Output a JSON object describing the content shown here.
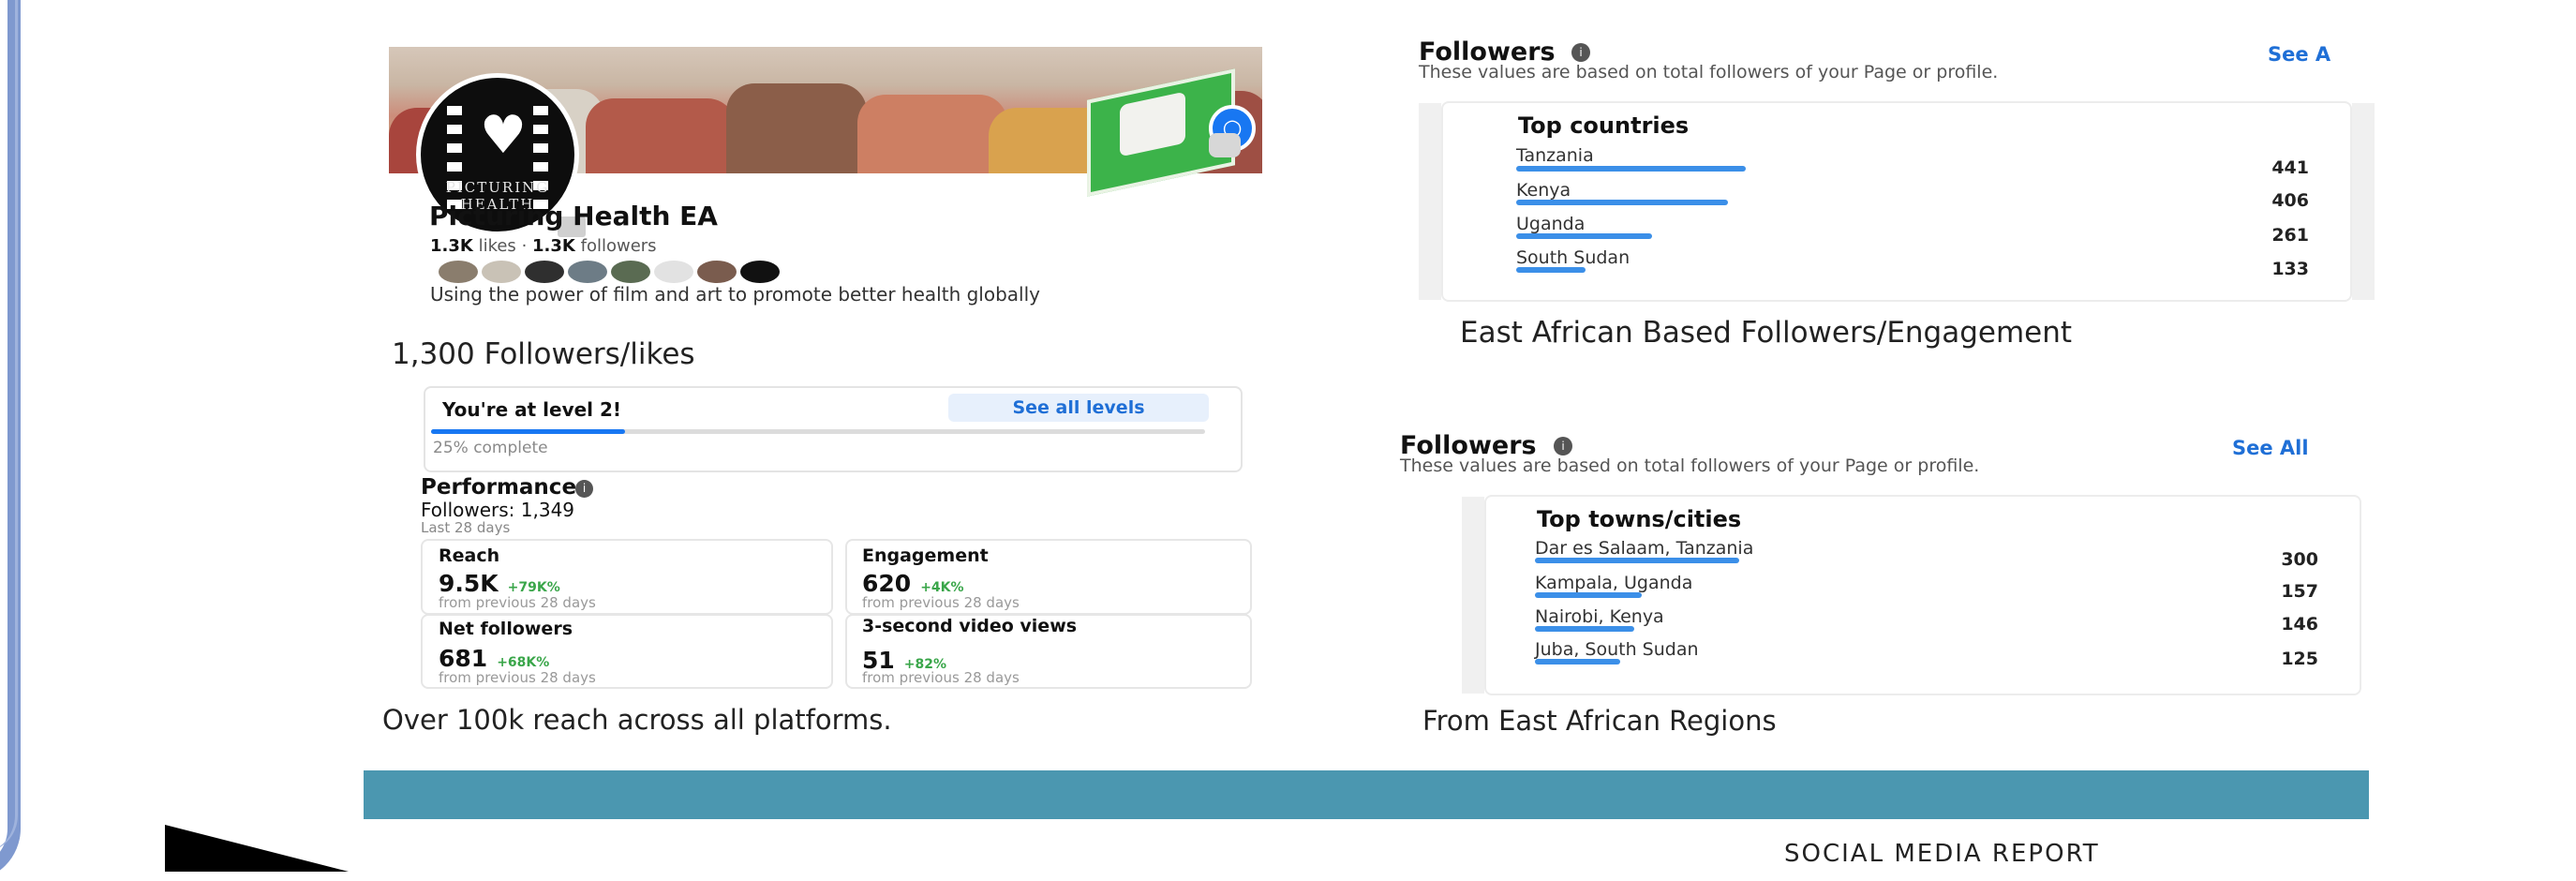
{
  "profile": {
    "avatar_text": "PICTURING HEALTH",
    "name": "Picturing Health EA",
    "likes_count": "1.3K",
    "likes_label": "likes",
    "separator": "·",
    "followers_count": "1.3K",
    "followers_label": "followers",
    "bio": "Using the power of film and art to promote better health globally"
  },
  "captions": {
    "followers_likes": "1,300 Followers/likes",
    "reach": "Over 100k reach across all platforms.",
    "east_african": "East African Based Followers/Engagement",
    "regions": "From East African Regions"
  },
  "level": {
    "title": "You're at level 2!",
    "see_all": "See all levels",
    "progress_percent": 25,
    "progress_text": "25% complete"
  },
  "performance": {
    "title": "Performance",
    "followers": "Followers: 1,349",
    "period": "Last 28 days",
    "metrics": [
      {
        "label": "Reach",
        "value": "9.5K",
        "change": "+79K%",
        "sub": "from previous 28 days"
      },
      {
        "label": "Engagement",
        "value": "620",
        "change": "+4K%",
        "sub": "from previous 28 days"
      },
      {
        "label": "Net followers",
        "value": "681",
        "change": "+68K%",
        "sub": "from previous 28 days"
      },
      {
        "label": "3-second video views",
        "value": "51",
        "change": "+82%",
        "sub": "from previous 28 days"
      }
    ]
  },
  "countries_panel": {
    "title": "Followers",
    "see_all": "See A",
    "description": "These values are based on total followers of your Page or profile.",
    "heading": "Top countries",
    "rows": [
      {
        "name": "Tanzania",
        "value": "441",
        "share": 441
      },
      {
        "name": "Kenya",
        "value": "406",
        "share": 406
      },
      {
        "name": "Uganda",
        "value": "261",
        "share": 261
      },
      {
        "name": "South Sudan",
        "value": "133",
        "share": 133
      }
    ]
  },
  "cities_panel": {
    "title": "Followers",
    "see_all": "See All",
    "description": "These values are based on total followers of your Page or profile.",
    "heading": "Top towns/cities",
    "rows": [
      {
        "name": "Dar es Salaam, Tanzania",
        "value": "300",
        "share": 300
      },
      {
        "name": "Kampala, Uganda",
        "value": "157",
        "share": 157
      },
      {
        "name": "Nairobi, Kenya",
        "value": "146",
        "share": 146
      },
      {
        "name": "Juba, South Sudan",
        "value": "125",
        "share": 125
      }
    ]
  },
  "footer": {
    "text": "SOCIAL MEDIA REPORT"
  },
  "colors": {
    "frame": "#7f99cf",
    "accent_blue": "#1877f2",
    "positive_green": "#3aa64a",
    "footer_band": "#4b97b0"
  }
}
